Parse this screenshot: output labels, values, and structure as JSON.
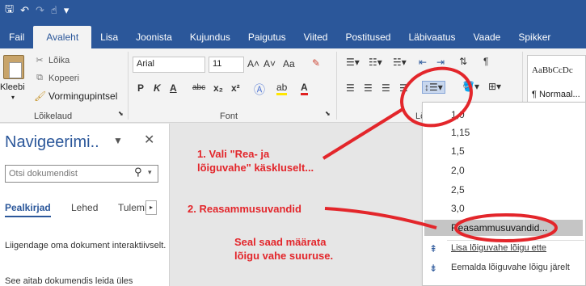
{
  "qat": {
    "icons": [
      "save-icon",
      "undo-icon",
      "redo-icon",
      "touch-mode-icon",
      "customize-icon"
    ],
    "glyph_save": "🖫",
    "glyph_undo": "↶",
    "glyph_redo": "↷",
    "glyph_touch": "☝",
    "glyph_more": "▾"
  },
  "tabs": [
    {
      "label": "Fail"
    },
    {
      "label": "Avaleht"
    },
    {
      "label": "Lisa"
    },
    {
      "label": "Joonista"
    },
    {
      "label": "Kujundus"
    },
    {
      "label": "Paigutus"
    },
    {
      "label": "Viited"
    },
    {
      "label": "Postitused"
    },
    {
      "label": "Läbivaatus"
    },
    {
      "label": "Vaade"
    },
    {
      "label": "Spikker"
    }
  ],
  "clipboard": {
    "paste_label": "Kleebi",
    "cut_label": "Lõika",
    "copy_label": "Kopeeri",
    "format_painter_label": "Vormingupintsel",
    "group_label": "Lõikelaud"
  },
  "font": {
    "family": "Arial",
    "size": "11",
    "group_label": "Font",
    "grow": "A˄",
    "shrink": "A˅",
    "case": "Aa",
    "bold": "P",
    "italic": "K",
    "underline": "A",
    "strike": "abc",
    "sub": "x₂",
    "sup": "x²"
  },
  "paragraph": {
    "group_label_partial": "Lõ"
  },
  "styles": {
    "sample": "AaBbCcDc",
    "normal": "¶ Normaal..."
  },
  "nav": {
    "title": "Navigeerimi..",
    "search_placeholder": "Otsi dokumendist",
    "tabs": [
      "Pealkirjad",
      "Lehed",
      "Tulemi"
    ],
    "p1": "Liigendage oma dokument interaktiivselt.",
    "p2": "See aitab dokumendis leida üles"
  },
  "annotations": {
    "a1_l1": "1. Vali \"Rea- ja",
    "a1_l2": "lõiguvahe\" käskluselt...",
    "a2": "2. Reasammusuvandid",
    "a3_l1": "Seal saad määrata",
    "a3_l2": "lõigu vahe suuruse."
  },
  "dropdown": {
    "items": [
      "1,0",
      "1,15",
      "1,5",
      "2,0",
      "2,5",
      "3,0"
    ],
    "options": "Reasammusuvandid...",
    "add_before": "Lisa lõiguvahe lõigu ette",
    "remove_after": "Eemalda lõiguvahe lõigu järelt"
  },
  "colors": {
    "accent": "#2b579a",
    "annotation": "#e3262b"
  }
}
